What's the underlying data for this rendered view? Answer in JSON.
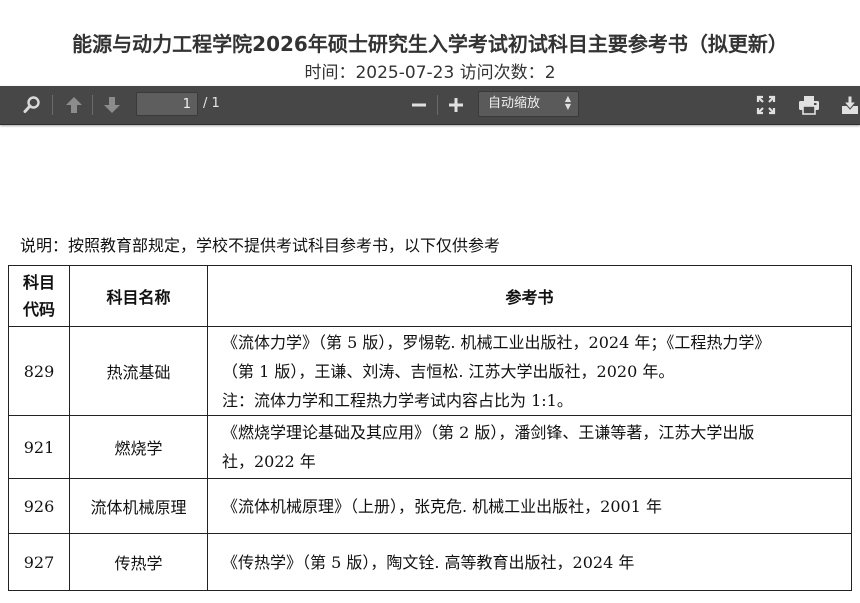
{
  "header": {
    "title": "能源与动力工程学院2026年硕士研究生入学考试初试科目主要参考书（拟更新）",
    "time_label": "时间：",
    "time_value": "2025-07-23",
    "visits_label": "访问次数：",
    "visits_value": "2"
  },
  "toolbar": {
    "page_current": "1",
    "page_total": "/ 1",
    "zoom_value": "自动缩放",
    "icons": {
      "search": "search-icon",
      "prev": "arrow-up-icon",
      "next": "arrow-down-icon",
      "zoom_out": "minus-icon",
      "zoom_in": "plus-icon",
      "fullscreen": "fullscreen-icon",
      "print": "print-icon",
      "download": "download-icon"
    },
    "colors": {
      "background": "#474747",
      "icon": "#d9d9d9"
    }
  },
  "document": {
    "note": "说明：按照教育部规定，学校不提供考试科目参考书，以下仅供参考",
    "table": {
      "headers": {
        "code_line1": "科目",
        "code_line2": "代码",
        "name": "科目名称",
        "book": "参考书"
      },
      "rows": [
        {
          "code": "829",
          "name": "热流基础",
          "book_lines": [
            "《流体力学》（第 5 版），罗惕乾. 机械工业出版社，2024 年；《工程热力学》",
            "（第 1 版），王谦、刘涛、吉恒松. 江苏大学出版社，2020 年。",
            "注：流体力学和工程热力学考试内容占比为 1:1。"
          ]
        },
        {
          "code": "921",
          "name": "燃烧学",
          "book_lines": [
            "《燃烧学理论基础及其应用》（第 2 版），潘剑锋、王谦等著，江苏大学出版",
            "社，2022 年"
          ]
        },
        {
          "code": "926",
          "name": "流体机械原理",
          "book_lines": [
            "《流体机械原理》（上册），张克危. 机械工业出版社，2001 年"
          ]
        },
        {
          "code": "927",
          "name": "传热学",
          "book_lines": [
            "《传热学》（第 5 版），陶文铨. 高等教育出版社，2024 年"
          ]
        }
      ]
    }
  }
}
